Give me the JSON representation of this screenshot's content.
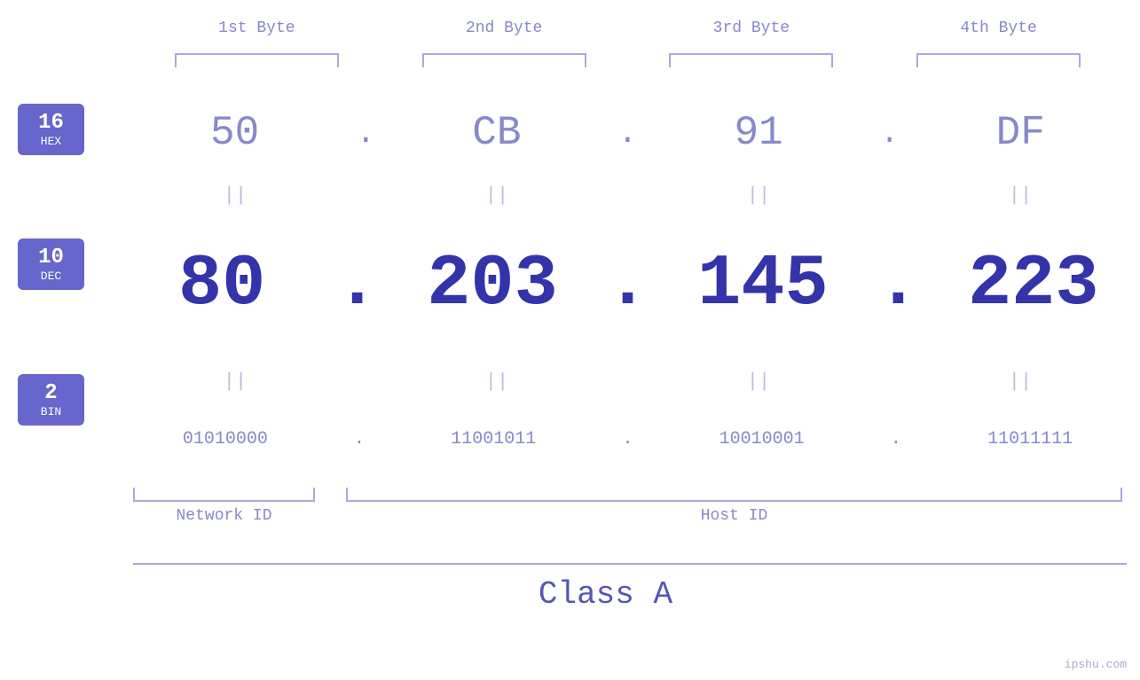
{
  "page": {
    "background": "#ffffff",
    "watermark": "ipshu.com"
  },
  "headers": {
    "byte1": "1st Byte",
    "byte2": "2nd Byte",
    "byte3": "3rd Byte",
    "byte4": "4th Byte"
  },
  "badges": [
    {
      "number": "16",
      "base": "HEX"
    },
    {
      "number": "10",
      "base": "DEC"
    },
    {
      "number": "2",
      "base": "BIN"
    }
  ],
  "rows": {
    "hex": {
      "values": [
        "50",
        "CB",
        "91",
        "DF"
      ],
      "dots": [
        ".",
        ".",
        "."
      ]
    },
    "dec": {
      "values": [
        "80",
        "203",
        "145",
        "223"
      ],
      "dots": [
        ".",
        ".",
        "."
      ]
    },
    "bin": {
      "values": [
        "01010000",
        "11001011",
        "10010001",
        "11011111"
      ],
      "dots": [
        ".",
        ".",
        "."
      ]
    }
  },
  "equals": "||",
  "labels": {
    "networkId": "Network ID",
    "hostId": "Host ID",
    "classA": "Class A"
  }
}
